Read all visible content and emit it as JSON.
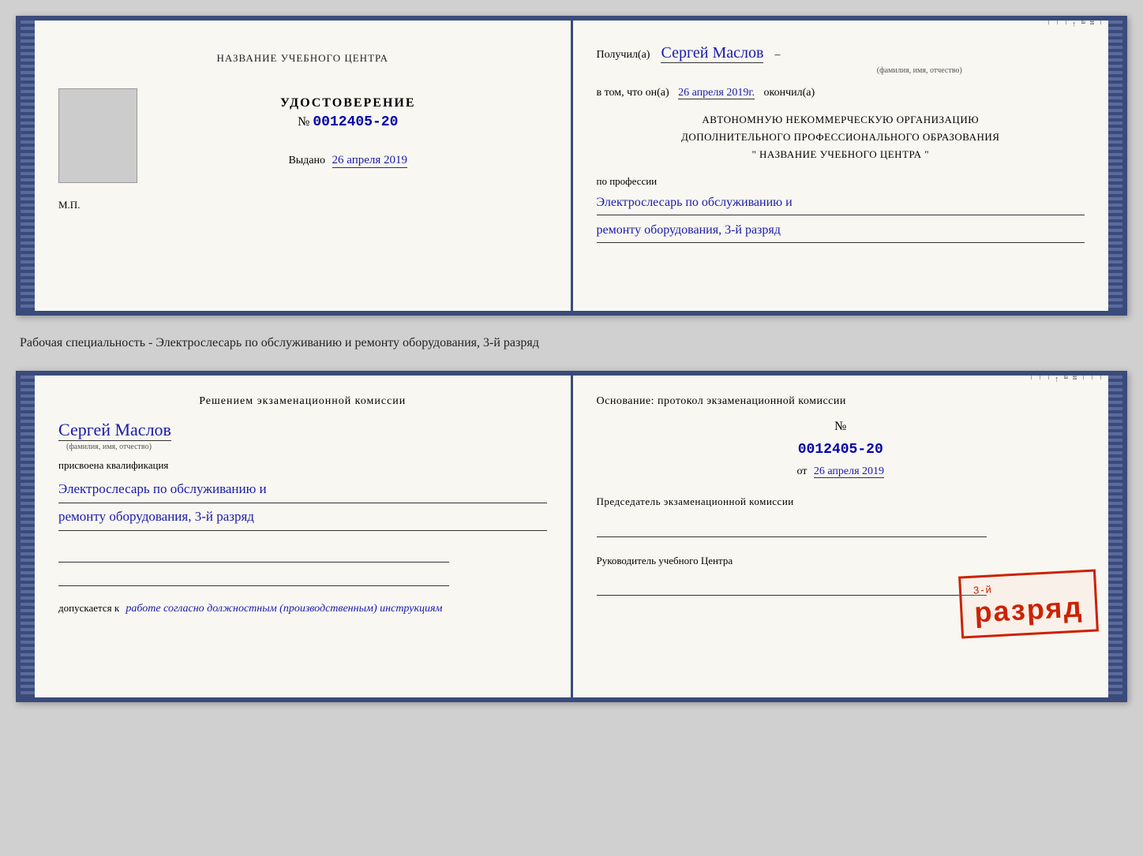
{
  "page": {
    "background": "#d0d0d0"
  },
  "cert1": {
    "left": {
      "header": "НАЗВАНИЕ УЧЕБНОГО ЦЕНТРА",
      "udostoverenie": "УДОСТОВЕРЕНИЕ",
      "number_prefix": "№",
      "number": "0012405-20",
      "vydano_label": "Выдано",
      "vydano_date": "26 апреля 2019",
      "mp": "М.П."
    },
    "right": {
      "poluchil_label": "Получил(а)",
      "recipient_name": "Сергей Маслов",
      "fio_label": "(фамилия, имя, отчество)",
      "vtom_prefix": "в том, что он(а)",
      "vtom_date": "26 апреля 2019г.",
      "okончil_label": "окончил(а)",
      "org_line1": "АВТОНОМНУЮ НЕКОММЕРЧЕСКУЮ ОРГАНИЗАЦИЮ",
      "org_line2": "ДОПОЛНИТЕЛЬНОГО ПРОФЕССИОНАЛЬНОГО ОБРАЗОВАНИЯ",
      "org_quotes": "\"",
      "org_name": "НАЗВАНИЕ УЧЕБНОГО ЦЕНТРА",
      "po_professii": "по профессии",
      "profession_line1": "Электрослесарь по обслуживанию и",
      "profession_line2": "ремонту оборудования, 3-й разряд"
    }
  },
  "between_text": "Рабочая специальность - Электрослесарь по обслуживанию и ремонту оборудования, 3-й разряд",
  "cert2": {
    "left": {
      "header": "Решением экзаменационной комиссии",
      "name": "Сергей Маслов",
      "fio_label": "(фамилия, имя, отчество)",
      "prisvoena": "присвоена квалификация",
      "qualification_line1": "Электрослесарь по обслуживанию и",
      "qualification_line2": "ремонту оборудования, 3-й разряд",
      "dopuskaetsya": "допускается к",
      "dopuskaetsya_text": "работе согласно должностным (производственным) инструкциям"
    },
    "right": {
      "osnovanie": "Основание: протокол экзаменационной комиссии",
      "number_prefix": "№",
      "number": "0012405-20",
      "ot_prefix": "от",
      "ot_date": "26 апреля 2019",
      "predsedatel_label": "Председатель экзаменационной комиссии",
      "rukovoditel_label": "Руководитель учебного Центра"
    },
    "stamp": {
      "line1": "3-й разряд"
    }
  }
}
